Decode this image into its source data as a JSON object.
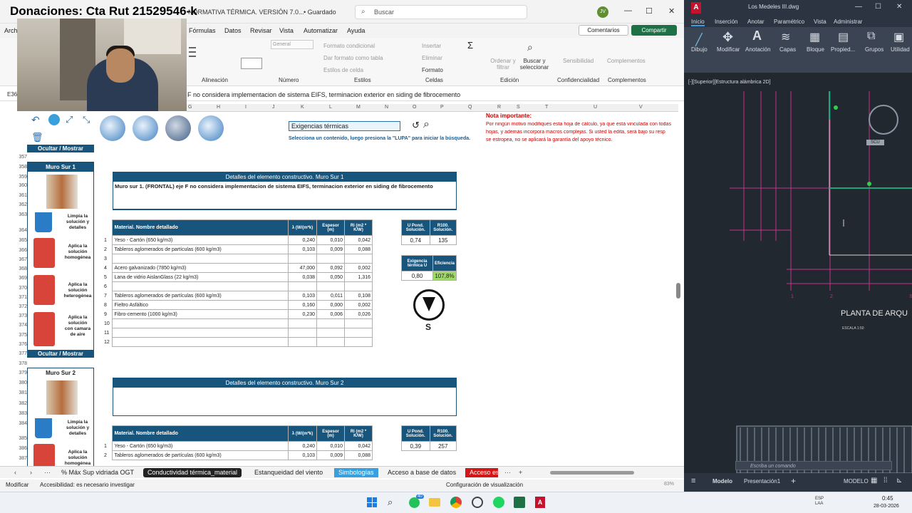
{
  "excel": {
    "overlay_text": "Donaciones: Cta Rut 21529546-k",
    "title": "NORMATIVA TÉRMICA. VERSIÓN 7.0...",
    "saved": "• Guardado",
    "search_placeholder": "Buscar",
    "avatar": "JV",
    "menu": [
      "Archivo",
      "Fórmulas",
      "Datos",
      "Revisar",
      "Vista",
      "Automatizar",
      "Ayuda"
    ],
    "comments": "Comentarios",
    "share": "Compartir",
    "ribbon": {
      "groups": [
        "Alineación",
        "Número",
        "Estilos",
        "Celdas",
        "Edición",
        "Confidencialidad",
        "Complementos"
      ],
      "numero_format": "General",
      "estilos": [
        "Formato condicional",
        "Dar formato como tabla",
        "Estilos de celda"
      ],
      "celdas": [
        "Insertar",
        "Eliminar",
        "Formato"
      ],
      "edicion": [
        "Ordenar y filtrar",
        "Buscar y seleccionar"
      ],
      "conf": "Sensibilidad",
      "comp": "Complementos"
    },
    "cell_ref": "E36",
    "formula": "F no considera implementacion de sistema EIFS, terminacion exterior en siding de fibrocemento",
    "columns": [
      "G",
      "H",
      "I",
      "J",
      "K",
      "L",
      "M",
      "N",
      "O",
      "P",
      "Q",
      "R",
      "S",
      "T",
      "U",
      "V"
    ],
    "search_box": "Exigencias térmicas",
    "search_hint": "Selecciona un contenido, luego presiona la \"LUPA\" para iniciar la búsqueda.",
    "note_title": "Nota importante:",
    "note_lines": [
      "Por ningún motivo modifiques esta hoja de cálculo, ya que está vinculada con todas las",
      "hojas, y además incorpora macros complejas. Si usted la edita, será bajo su resp",
      "se estropea, no se aplicará la garantía del apoyo técnico."
    ],
    "ocultar": "Ocultar / Mostrar",
    "muro1": {
      "title": "Muro Sur 1",
      "details_header": "Detalles del elemento constructivo. Muro Sur 1",
      "details_text": "Muro sur 1. (FRONTAL) eje F no considera implementacion de sistema EIFS, terminacion exterior en siding de fibrocemento",
      "headers": [
        "Material. Nombre detallado",
        "λ (W/(m*k)",
        "Espesor (m)",
        "Ri (m2 * K/W)"
      ],
      "rows": [
        [
          "1",
          "Yeso - Cartón (650 kg/m3)",
          "0,240",
          "0,010",
          "0,042"
        ],
        [
          "2",
          "Tableros aglomerados de partículas (600 kg/m3)",
          "0,103",
          "0,009",
          "0,088"
        ],
        [
          "3",
          "",
          "",
          "",
          ""
        ],
        [
          "4",
          "Acero galvanizado (7850 kg/m3)",
          "47,000",
          "0,092",
          "0,002"
        ],
        [
          "5",
          "Lana de vidrio AislanGlass (22 kg/m3)",
          "0,038",
          "0,050",
          "1,316"
        ],
        [
          "6",
          "",
          "",
          "",
          ""
        ],
        [
          "7",
          "Tableros aglomerados de partículas (600 kg/m3)",
          "0,103",
          "0,011",
          "0,108"
        ],
        [
          "8",
          "Fieltro Asfáltico",
          "0,160",
          "0,000",
          "0,002"
        ],
        [
          "9",
          "Fibro-cemento (1000 kg/m3)",
          "0,230",
          "0,006",
          "0,026"
        ],
        [
          "10",
          "",
          "",
          "",
          ""
        ],
        [
          "11",
          "",
          "",
          "",
          ""
        ],
        [
          "12",
          "",
          "",
          "",
          ""
        ]
      ],
      "u_pond_label": "U Pond. Solución.",
      "r100_label": "R100. Solución.",
      "u_pond": "0,74",
      "r100": "135",
      "exig_label": "Exigencia térmica U",
      "efic_label": "Eficiencia",
      "exig": "0,80",
      "efic": "107,8%",
      "compass": "S"
    },
    "muro2": {
      "title": "Muro Sur 2",
      "details_header": "Detalles del elemento constructivo. Muro Sur 2",
      "rows": [
        [
          "1",
          "Yeso - Cartón (650 kg/m3)",
          "0,240",
          "0,010",
          "0,042"
        ],
        [
          "2",
          "Tableros aglomerados de partículas (600 kg/m3)",
          "0,103",
          "0,009",
          "0,088"
        ]
      ],
      "u_pond": "0,39",
      "r100": "257"
    },
    "side_labels": {
      "limpia": "Limpia la solución y detalles",
      "homo": "Aplica la solución homogénea",
      "hetero": "Aplica la solución heterogénea",
      "aire": "Aplica la solución con camara de aire"
    },
    "row_numbers": [
      "357",
      "358",
      "359",
      "360",
      "361",
      "362",
      "363",
      "364",
      "365",
      "366",
      "367",
      "368",
      "369",
      "370",
      "371",
      "372",
      "373",
      "374",
      "375",
      "376",
      "377",
      "378",
      "379",
      "380",
      "381",
      "382",
      "383",
      "384",
      "385",
      "386",
      "387"
    ],
    "tabs": [
      "% Máx Sup vidriada OGT",
      "Conductividad térmica_material",
      "Estanqueidad del viento",
      "Simbologías",
      "Acceso a base de datos",
      "Acceso es"
    ],
    "status": [
      "Modificar",
      "Accesibilidad: es necesario investigar",
      "Configuración de visualización",
      "83%"
    ]
  },
  "acad": {
    "title": "Los Medeles III.dwg",
    "tabs": [
      "Inicio",
      "Inserción",
      "Anotar",
      "Paramétrico",
      "Vista",
      "Administrar"
    ],
    "tools": [
      "Dibujo",
      "Modificar",
      "Anotación",
      "Capas",
      "Bloque",
      "Propied...",
      "Grupos",
      "Utilidad"
    ],
    "viewport": "[-][Superior][Estructura alámbrica 2D]",
    "plan_title": "PLANTA DE ARQU",
    "scale": "ESCALA 1:50",
    "command": "Escriba un comando",
    "bottom_tabs": [
      "Modelo",
      "Presentación1"
    ],
    "model": "MODELO",
    "scu": "SCU"
  },
  "taskbar": {
    "time": "0:45",
    "date": "28-03-2026",
    "lang": "ESP LAA",
    "badge": "40"
  }
}
